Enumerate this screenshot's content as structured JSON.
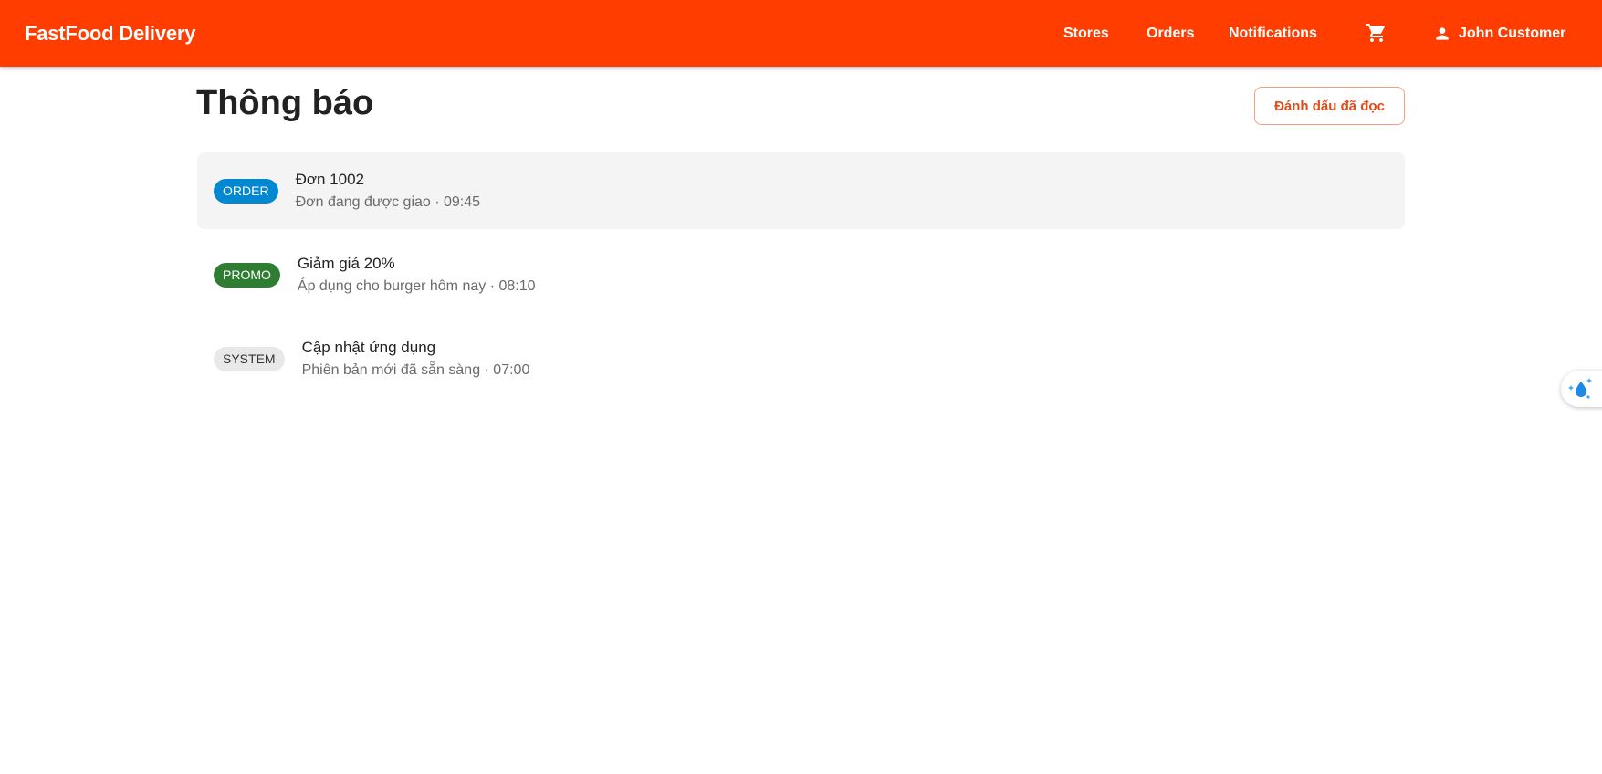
{
  "header": {
    "brand": "FastFood Delivery",
    "nav": [
      "Stores",
      "Orders",
      "Notifications"
    ],
    "cart_icon": "cart-icon",
    "user_icon": "person-icon",
    "user_name": "John Customer",
    "bg_color": "#ff3d00"
  },
  "page": {
    "title": "Thông báo",
    "mark_read_label": "Đánh dấu đã đọc"
  },
  "notifications": [
    {
      "tag": "ORDER",
      "tag_color": "#0288d1",
      "title": "Đơn 1002",
      "subtitle": "Đơn đang được giao · 09:45",
      "highlighted": true
    },
    {
      "tag": "PROMO",
      "tag_color": "#2e7d32",
      "title": "Giảm giá 20%",
      "subtitle": "Áp dụng cho burger hôm nay · 08:10",
      "highlighted": false
    },
    {
      "tag": "SYSTEM",
      "tag_color": "#e8e8e8",
      "title": "Cập nhật ứng dụng",
      "subtitle": "Phiên bản mới đã sẵn sàng · 07:00",
      "highlighted": false
    }
  ],
  "floating_button": {
    "icon": "droplet-sparkle-icon"
  }
}
